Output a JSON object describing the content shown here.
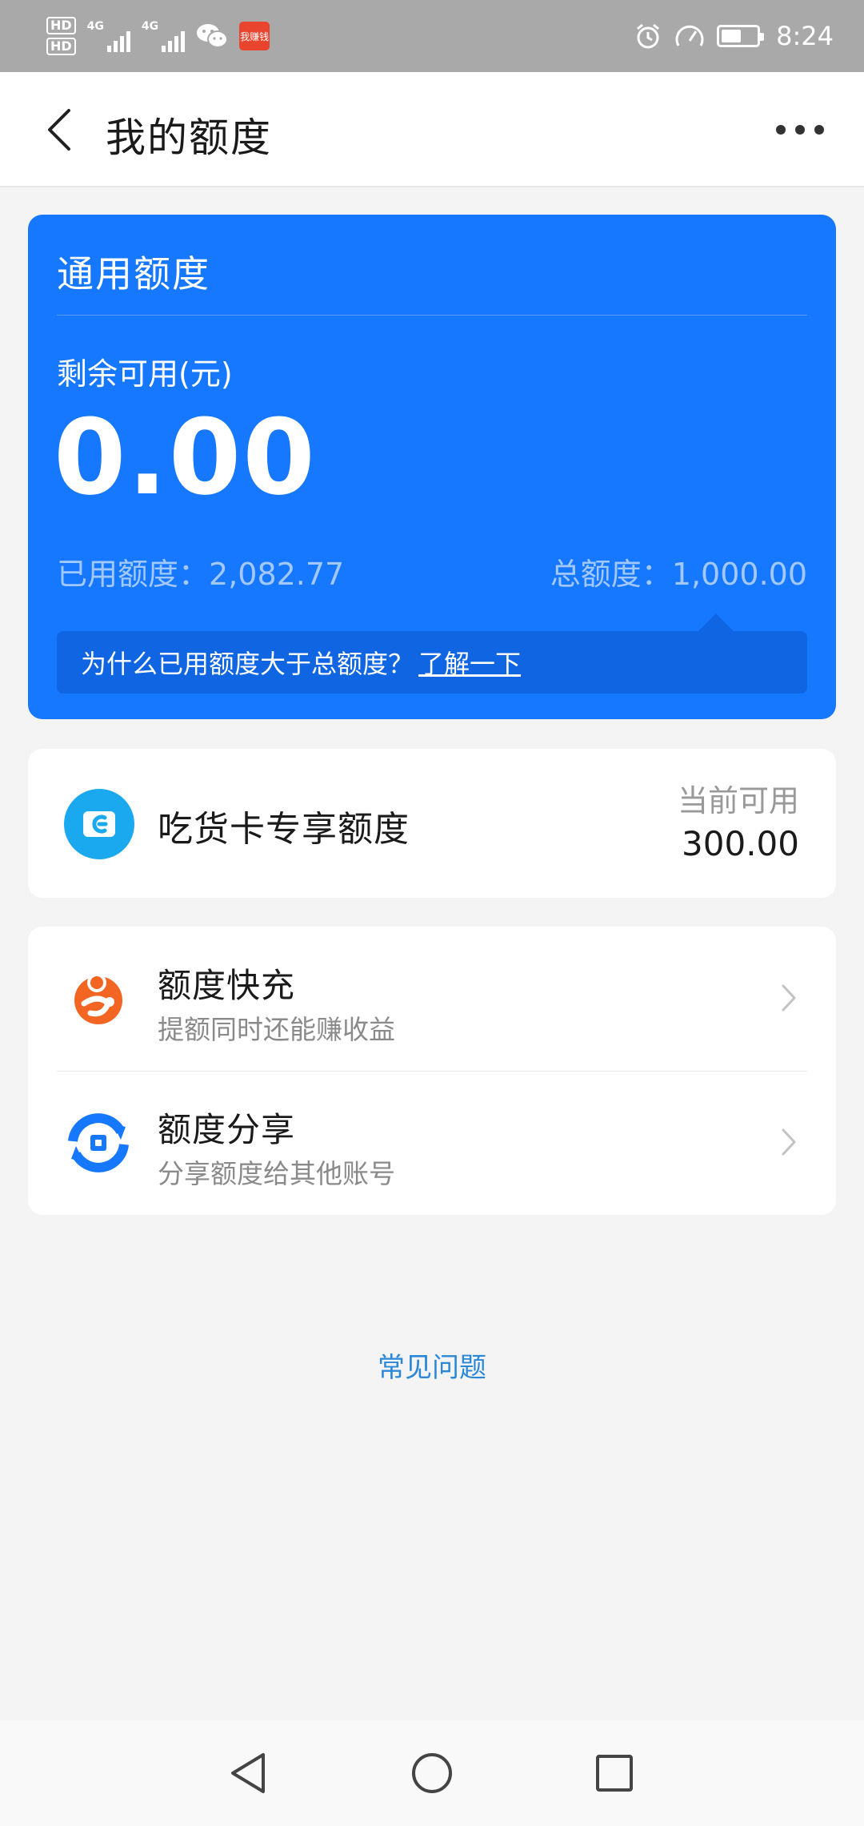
{
  "status_bar": {
    "time": "8:24",
    "network_1": "4G",
    "network_2": "4G",
    "app_badge": "我赚钱"
  },
  "header": {
    "title": "我的额度"
  },
  "quota_card": {
    "title": "通用额度",
    "remain_label": "剩余可用(元)",
    "remain_value": "0.00",
    "used_label": "已用额度：",
    "used_value": "2,082.77",
    "total_label": "总额度：",
    "total_value": "1,000.00",
    "tip_text": "为什么已用额度大于总额度？",
    "tip_link": "了解一下"
  },
  "snack_card": {
    "title": "吃货卡专享额度",
    "avail_label": "当前可用",
    "avail_value": "300.00"
  },
  "list": {
    "items": [
      {
        "title": "额度快充",
        "subtitle": "提额同时还能赚收益"
      },
      {
        "title": "额度分享",
        "subtitle": "分享额度给其他账号"
      }
    ]
  },
  "faq": {
    "label": "常见问题"
  },
  "colors": {
    "primary": "#1677ff",
    "orange": "#f26522",
    "link": "#2b88d8"
  }
}
